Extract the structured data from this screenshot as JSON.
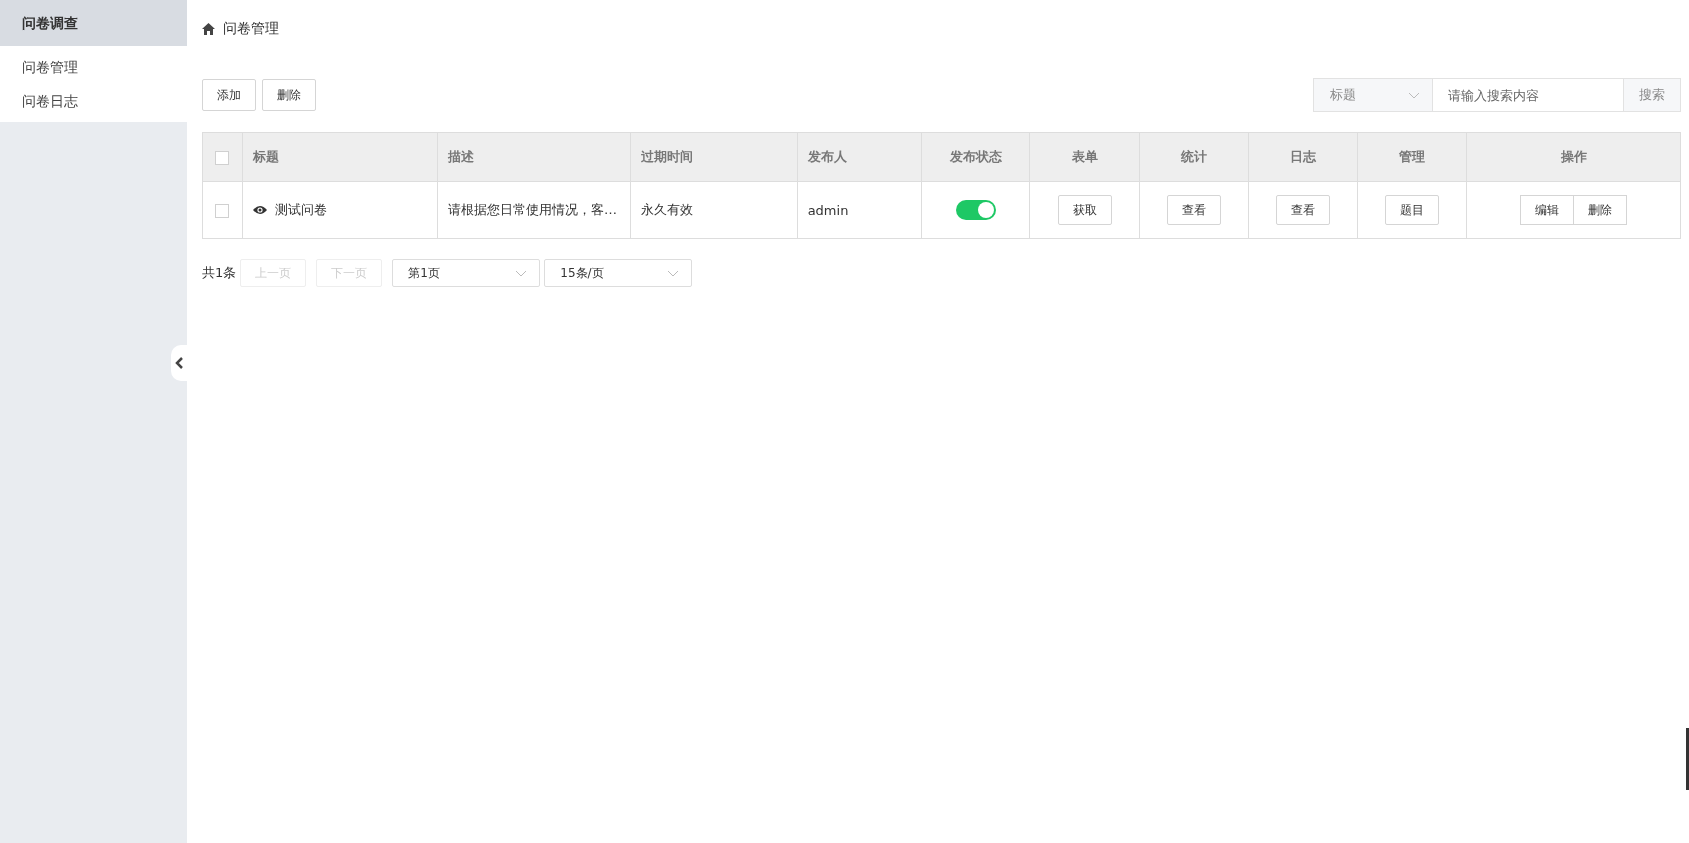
{
  "sidebar": {
    "title": "问卷调查",
    "items": [
      {
        "label": "问卷管理"
      },
      {
        "label": "问卷日志"
      }
    ]
  },
  "breadcrumb": "问卷管理",
  "toolbar": {
    "buttons": [
      "添加",
      "删除"
    ]
  },
  "search": {
    "field": "标题",
    "placeholder": "请输入搜索内容",
    "button": "搜索"
  },
  "table": {
    "all_checked": false,
    "columns": [
      "标题",
      "描述",
      "过期时间",
      "发布人",
      "发布状态",
      "表单",
      "统计",
      "日志",
      "管理",
      "操作"
    ],
    "rows": [
      {
        "checked": false,
        "cells": [
          {
            "kind": "title",
            "text": "测试问卷"
          },
          {
            "kind": "text",
            "text": "请根据您日常使用情况，客…"
          },
          {
            "kind": "text",
            "text": "永久有效"
          },
          {
            "kind": "text",
            "text": "admin"
          },
          {
            "kind": "switch",
            "on": true
          },
          {
            "kind": "buttons",
            "buttons": [
              "获取"
            ]
          },
          {
            "kind": "buttons",
            "buttons": [
              "查看"
            ]
          },
          {
            "kind": "buttons",
            "buttons": [
              "查看"
            ]
          },
          {
            "kind": "buttons",
            "buttons": [
              "题目"
            ]
          },
          {
            "kind": "group",
            "buttons": [
              "编辑",
              "删除"
            ]
          }
        ]
      }
    ]
  },
  "pagination": {
    "total": "共1条",
    "prev": "上一页",
    "next": "下一页",
    "page": "第1页",
    "page_size": "15条/页"
  }
}
